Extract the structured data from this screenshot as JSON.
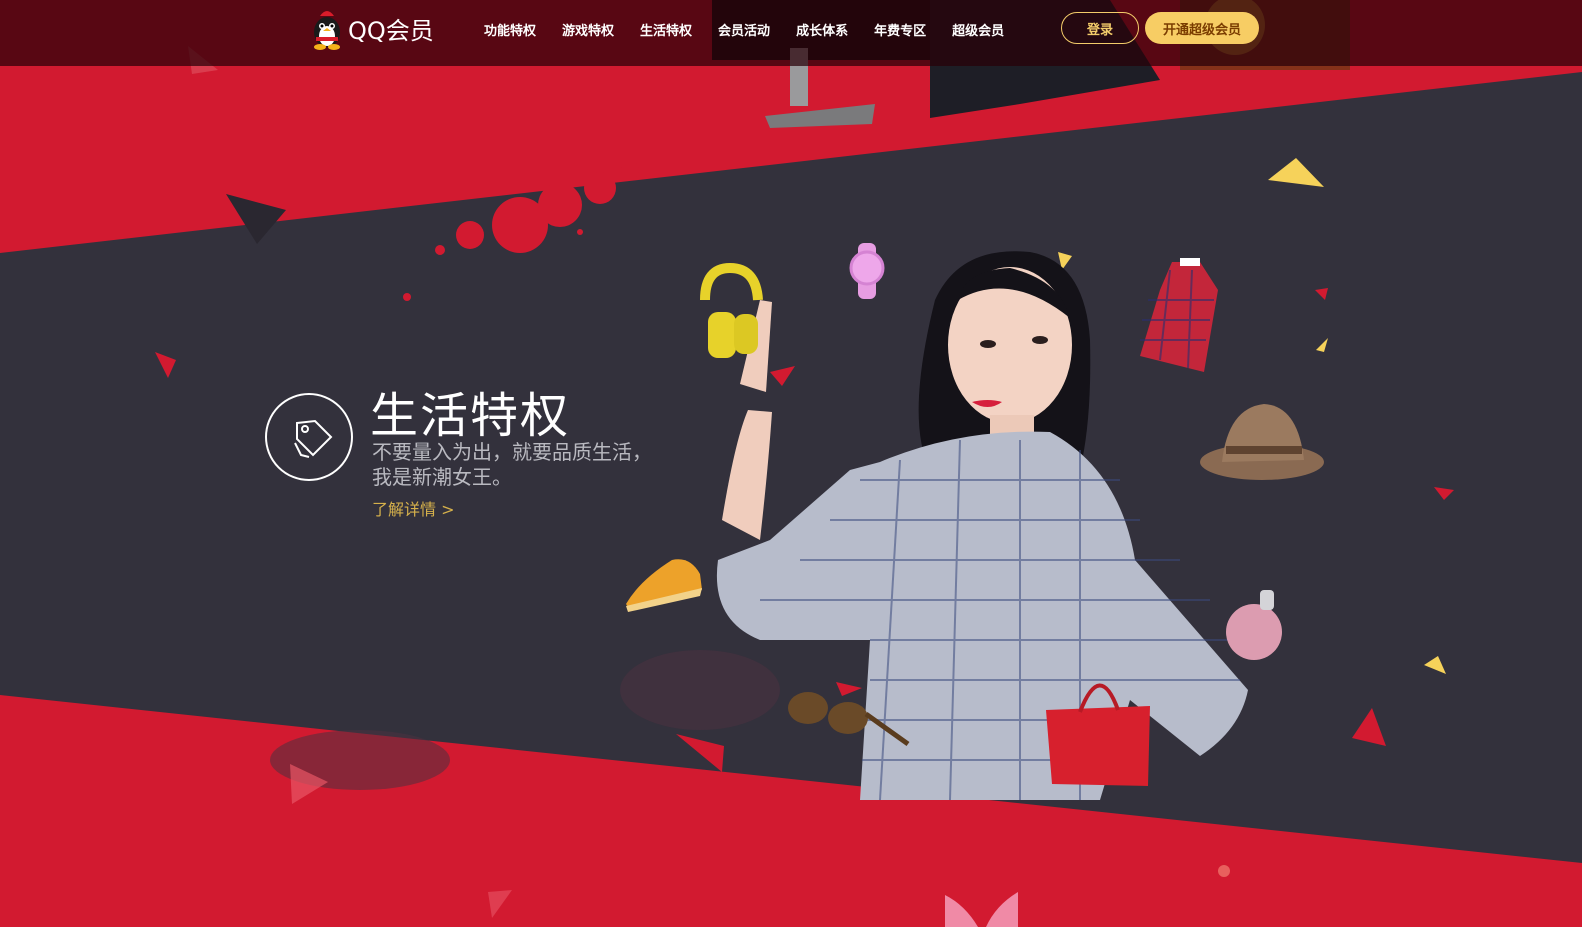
{
  "header": {
    "logo_text": "QQ会员",
    "nav": [
      "功能特权",
      "游戏特权",
      "生活特权",
      "会员活动",
      "成长体系",
      "年费专区",
      "超级会员"
    ],
    "login_label": "登录",
    "open_label": "开通超级会员"
  },
  "feature": {
    "title": "生活特权",
    "desc_line1": "不要量入为出，就要品质生活，",
    "desc_line2": "我是新潮女王。",
    "link": "了解详情 >"
  },
  "colors": {
    "red": "#d21a30",
    "dark": "#33313c",
    "gold": "#f7cd64",
    "yellow": "#f6d25a"
  },
  "icons": [
    "qq-penguin-icon",
    "tag-icon"
  ]
}
